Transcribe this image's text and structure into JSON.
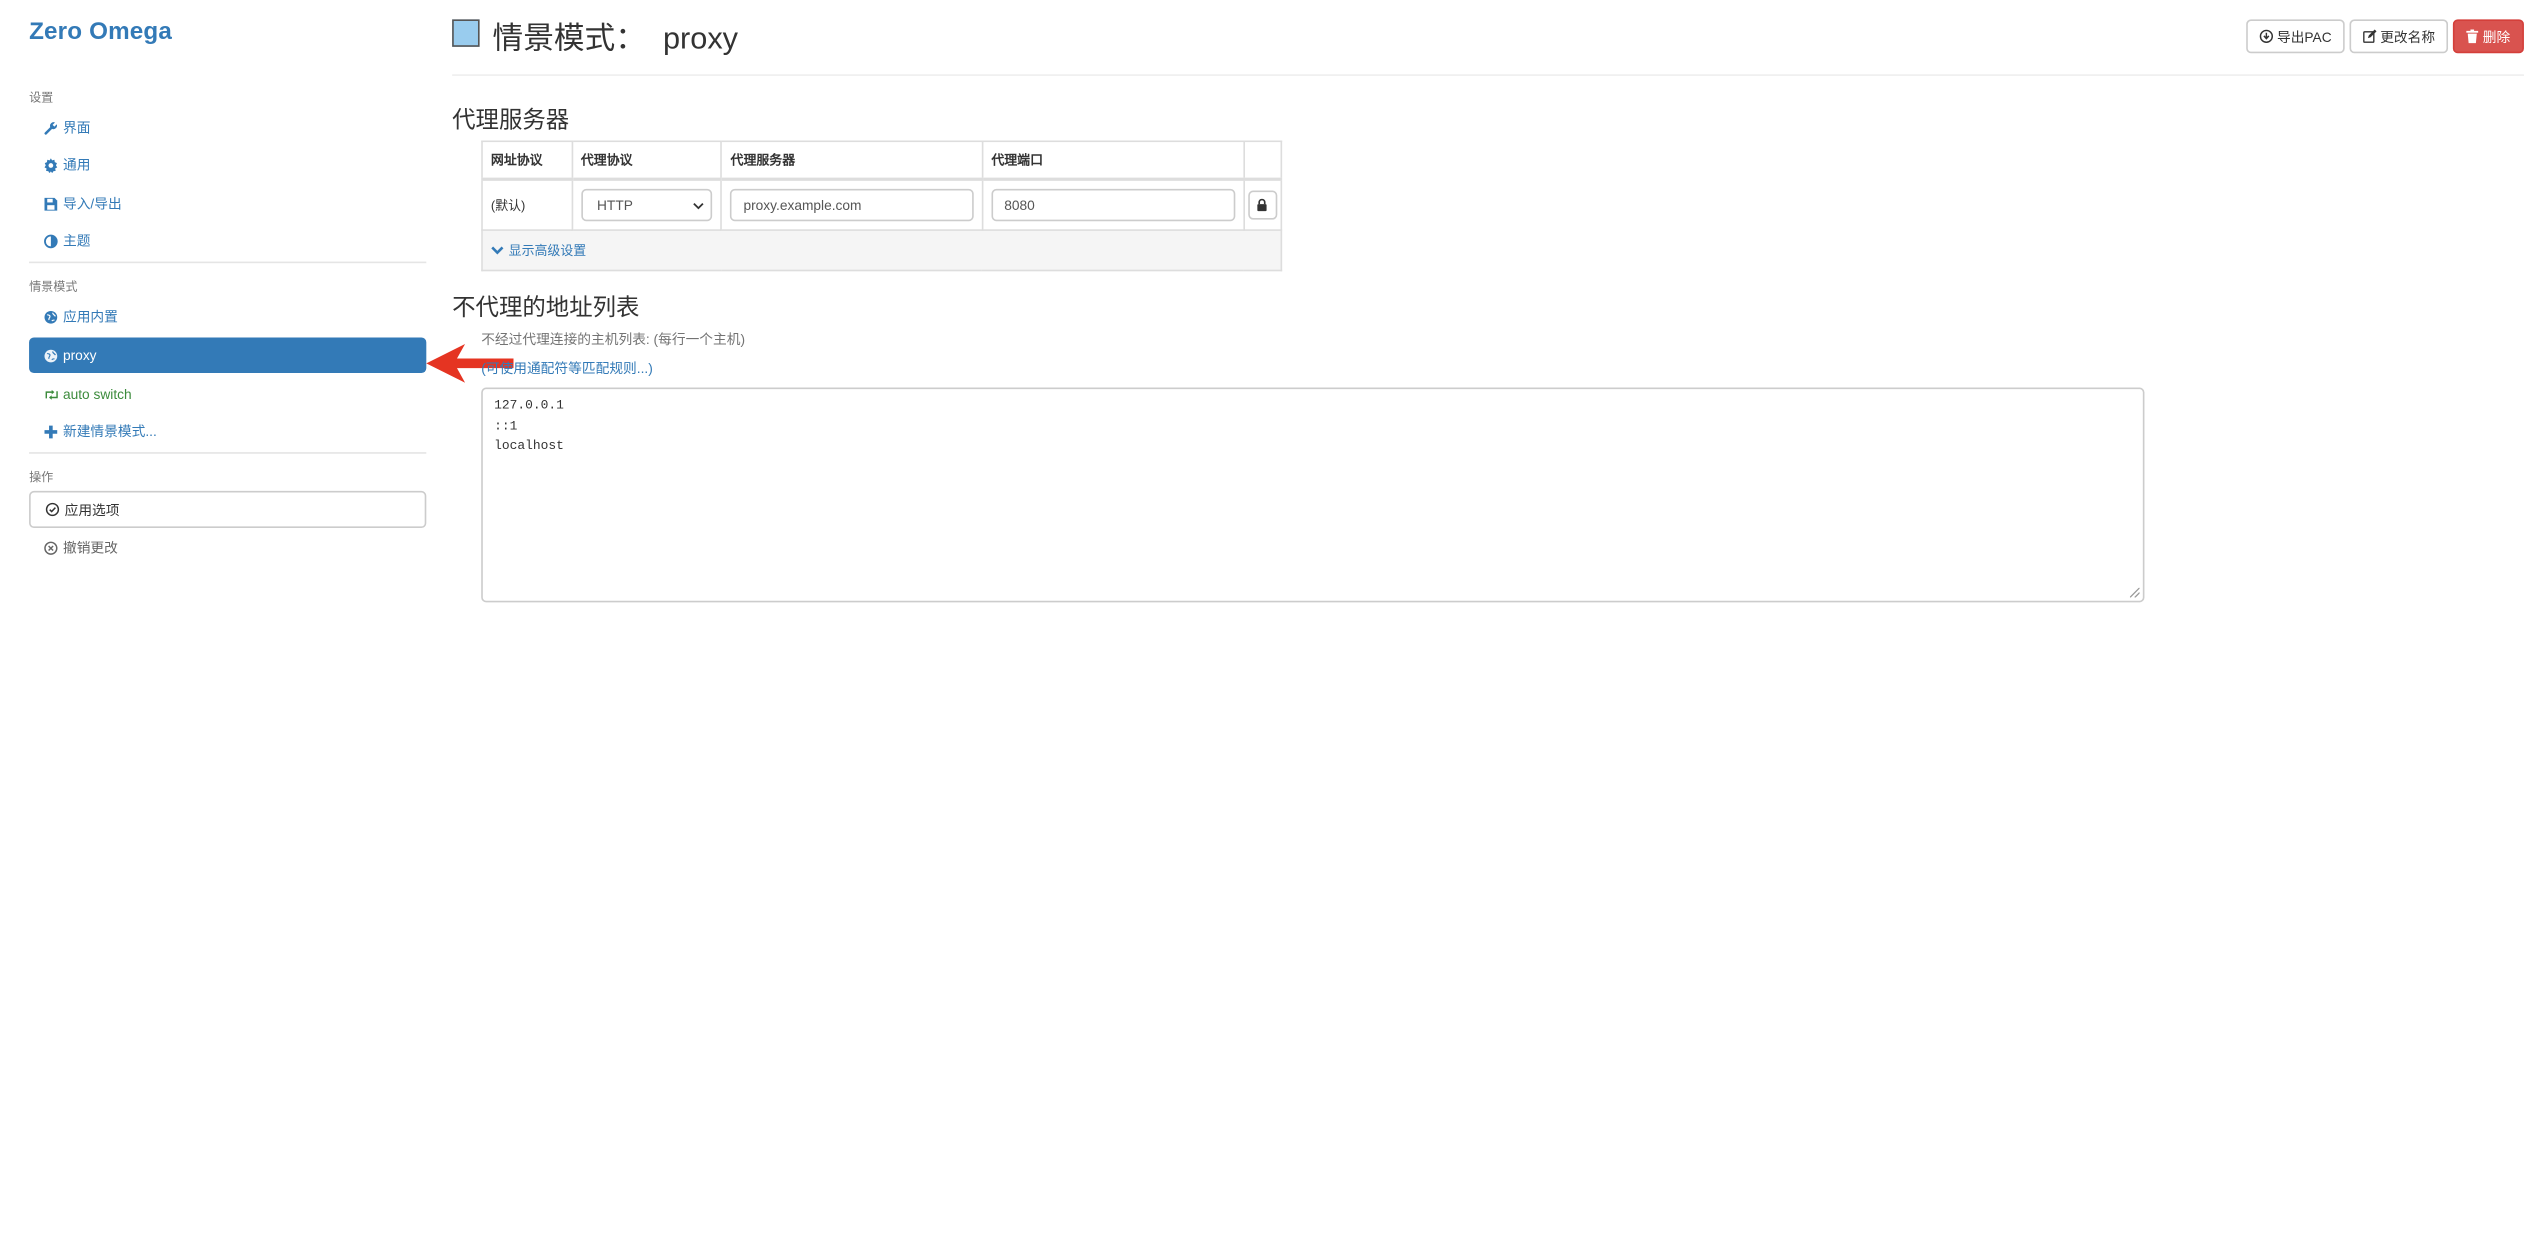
{
  "app": {
    "brand": "Zero Omega"
  },
  "sidebar": {
    "sections": {
      "settings": "设置",
      "profiles": "情景模式",
      "actions": "操作"
    },
    "settings_items": [
      {
        "label": "界面",
        "icon": "wrench-icon"
      },
      {
        "label": "通用",
        "icon": "gear-icon"
      },
      {
        "label": "导入/导出",
        "icon": "floppy-icon"
      },
      {
        "label": "主题",
        "icon": "contrast-icon"
      }
    ],
    "profile_items": [
      {
        "label": "应用内置",
        "icon": "globe-icon"
      },
      {
        "label": "proxy",
        "icon": "globe-icon",
        "active": true
      },
      {
        "label": "auto switch",
        "icon": "retweet-icon"
      },
      {
        "label": "新建情景模式...",
        "icon": "plus-icon"
      }
    ],
    "actions": {
      "apply": "应用选项",
      "revert": "撤销更改"
    }
  },
  "header": {
    "title": "情景模式：  proxy",
    "profile_color": "#99ccee",
    "buttons": {
      "export_pac": "导出PAC",
      "rename": "更改名称",
      "delete": "删除"
    }
  },
  "proxy_servers": {
    "heading": "代理服务器",
    "columns": [
      "网址协议",
      "代理协议",
      "代理服务器",
      "代理端口"
    ],
    "row": {
      "scheme": "(默认)",
      "protocol": "HTTP",
      "host_placeholder": "proxy.example.com",
      "port_placeholder": "8080"
    },
    "advanced_toggle": "显示高级设置"
  },
  "bypass": {
    "heading": "不代理的地址列表",
    "help": "不经过代理连接的主机列表: (每行一个主机)",
    "wildcard_link": "(可使用通配符等匹配规则...)",
    "lines": [
      "127.0.0.1",
      "::1",
      "localhost"
    ]
  },
  "colors": {
    "accent": "#337ab7",
    "danger": "#d9534f",
    "annotation_arrow": "#e53422"
  }
}
